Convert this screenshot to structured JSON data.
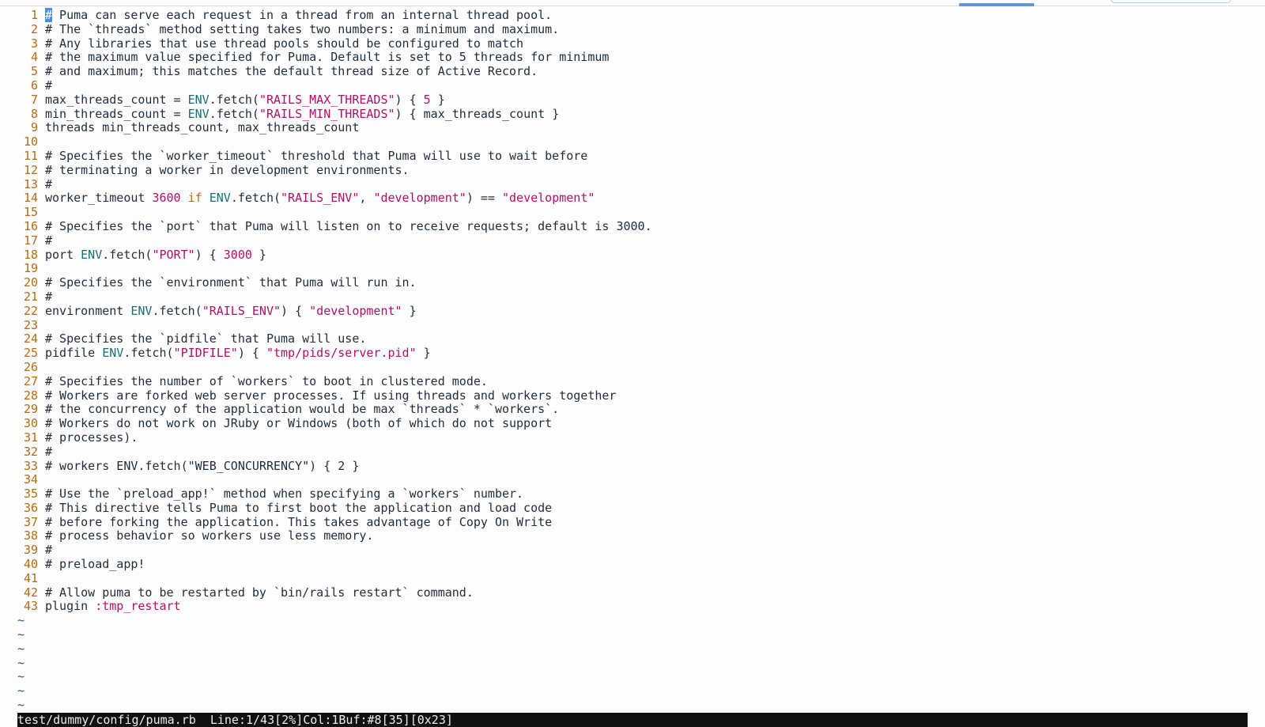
{
  "editor": {
    "cursor_char": "#",
    "lines": [
      {
        "n": "1",
        "text": " Puma can serve each request in a thread from an internal thread pool."
      },
      {
        "n": "2",
        "text": "# The `threads` method setting takes two numbers: a minimum and maximum."
      },
      {
        "n": "3",
        "text": "# Any libraries that use thread pools should be configured to match"
      },
      {
        "n": "4",
        "text": "# the maximum value specified for Puma. Default is set to 5 threads for minimum"
      },
      {
        "n": "5",
        "text": "# and maximum; this matches the default thread size of Active Record."
      },
      {
        "n": "6",
        "text": "#"
      },
      {
        "n": "7",
        "text": ""
      },
      {
        "n": "8",
        "text": ""
      },
      {
        "n": "9",
        "text": "threads min_threads_count, max_threads_count"
      },
      {
        "n": "10",
        "text": ""
      },
      {
        "n": "11",
        "text": "# Specifies the `worker_timeout` threshold that Puma will use to wait before"
      },
      {
        "n": "12",
        "text": "# terminating a worker in development environments."
      },
      {
        "n": "13",
        "text": "#"
      },
      {
        "n": "14",
        "text": ""
      },
      {
        "n": "15",
        "text": ""
      },
      {
        "n": "16",
        "text": "# Specifies the `port` that Puma will listen on to receive requests; default is 3000."
      },
      {
        "n": "17",
        "text": "#"
      },
      {
        "n": "18",
        "text": ""
      },
      {
        "n": "19",
        "text": ""
      },
      {
        "n": "20",
        "text": "# Specifies the `environment` that Puma will run in."
      },
      {
        "n": "21",
        "text": "#"
      },
      {
        "n": "22",
        "text": ""
      },
      {
        "n": "23",
        "text": ""
      },
      {
        "n": "24",
        "text": "# Specifies the `pidfile` that Puma will use."
      },
      {
        "n": "25",
        "text": ""
      },
      {
        "n": "26",
        "text": ""
      },
      {
        "n": "27",
        "text": "# Specifies the number of `workers` to boot in clustered mode."
      },
      {
        "n": "28",
        "text": "# Workers are forked web server processes. If using threads and workers together"
      },
      {
        "n": "29",
        "text": "# the concurrency of the application would be max `threads` * `workers`."
      },
      {
        "n": "30",
        "text": "# Workers do not work on JRuby or Windows (both of which do not support"
      },
      {
        "n": "31",
        "text": "# processes)."
      },
      {
        "n": "32",
        "text": "#"
      },
      {
        "n": "33",
        "text": "# workers ENV.fetch(\"WEB_CONCURRENCY\") { 2 }"
      },
      {
        "n": "34",
        "text": ""
      },
      {
        "n": "35",
        "text": "# Use the `preload_app!` method when specifying a `workers` number."
      },
      {
        "n": "36",
        "text": "# This directive tells Puma to first boot the application and load code"
      },
      {
        "n": "37",
        "text": "# before forking the application. This takes advantage of Copy On Write"
      },
      {
        "n": "38",
        "text": "# process behavior so workers use less memory."
      },
      {
        "n": "39",
        "text": "#"
      },
      {
        "n": "40",
        "text": "# preload_app!"
      },
      {
        "n": "41",
        "text": ""
      },
      {
        "n": "42",
        "text": "# Allow puma to be restarted by `bin/rails restart` command."
      },
      {
        "n": "43",
        "text": ""
      }
    ],
    "code": {
      "l7": [
        "max_threads_count = ",
        "ENV",
        ".fetch(",
        "\"RAILS_MAX_THREADS\"",
        ") { ",
        "5",
        " }"
      ],
      "l8": [
        "min_threads_count = ",
        "ENV",
        ".fetch(",
        "\"RAILS_MIN_THREADS\"",
        ") { max_threads_count }"
      ],
      "l14": [
        "worker_timeout ",
        "3600",
        " ",
        "if",
        " ",
        "ENV",
        ".fetch(",
        "\"RAILS_ENV\"",
        ", ",
        "\"development\"",
        ") == ",
        "\"development\""
      ],
      "l18": [
        "port ",
        "ENV",
        ".fetch(",
        "\"PORT\"",
        ") { ",
        "3000",
        " }"
      ],
      "l22": [
        "environment ",
        "ENV",
        ".fetch(",
        "\"RAILS_ENV\"",
        ") { ",
        "\"development\"",
        " }"
      ],
      "l25": [
        "pidfile ",
        "ENV",
        ".fetch(",
        "\"PIDFILE\"",
        ") { ",
        "\"tmp/pids/server.pid\"",
        " }"
      ],
      "l43": [
        "plugin ",
        ":tmp_restart"
      ]
    },
    "tilde": "~",
    "tilde_count": 7
  },
  "status_bar": {
    "text": "test/dummy/config/puma.rb  Line:1/43[2%]Col:1Buf:#8[35][0x23]"
  },
  "colors": {
    "line_number": "#b46a17",
    "string": "#b0106a",
    "constant": "#1a6d74",
    "cursor": "#4b8fe4",
    "status_bg": "#111111"
  }
}
